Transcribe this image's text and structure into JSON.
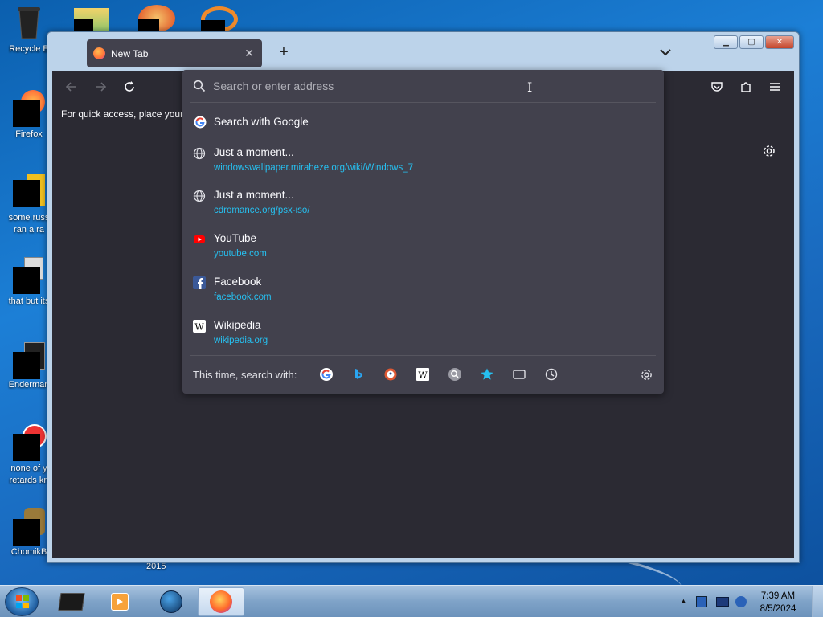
{
  "desktop": {
    "icons": [
      {
        "label": "Recycle B"
      },
      {
        "label": "Firefox"
      },
      {
        "label": "some russ",
        "label2": "ran a ra"
      },
      {
        "label": "that but its"
      },
      {
        "label": "Enderman"
      },
      {
        "label": "none of y",
        "label2": "retards kn"
      },
      {
        "label": "ChomikB"
      }
    ],
    "year_label": "2015"
  },
  "browser": {
    "tab": {
      "title": "New Tab"
    },
    "bookmarks_bar_text": "For quick access, place your b",
    "urlbar": {
      "placeholder": "Search or enter address",
      "search_with": "Search with Google",
      "results": [
        {
          "title": "Just a moment...",
          "url": "windowswallpaper.miraheze.org/wiki/Windows_7",
          "icon": "globe-icon"
        },
        {
          "title": "Just a moment...",
          "url": "cdromance.org/psx-iso/",
          "icon": "globe-icon"
        },
        {
          "title": "YouTube",
          "url": "youtube.com",
          "icon": "youtube-icon"
        },
        {
          "title": "Facebook",
          "url": "facebook.com",
          "icon": "facebook-icon"
        },
        {
          "title": "Wikipedia",
          "url": "wikipedia.org",
          "icon": "wikipedia-icon"
        }
      ],
      "oneoff_label": "This time, search with:",
      "oneoff_engines": [
        "google-icon",
        "bing-icon",
        "duckduckgo-icon",
        "wikipedia-icon",
        "search-engine-icon",
        "bookmarks-star-icon",
        "tabs-icon",
        "history-icon"
      ]
    }
  },
  "taskbar": {
    "time": "7:39 AM",
    "date": "8/5/2024"
  },
  "colors": {
    "url_link": "#26c0f0",
    "panel_bg": "#42414d",
    "page_bg": "#2b2a33"
  }
}
